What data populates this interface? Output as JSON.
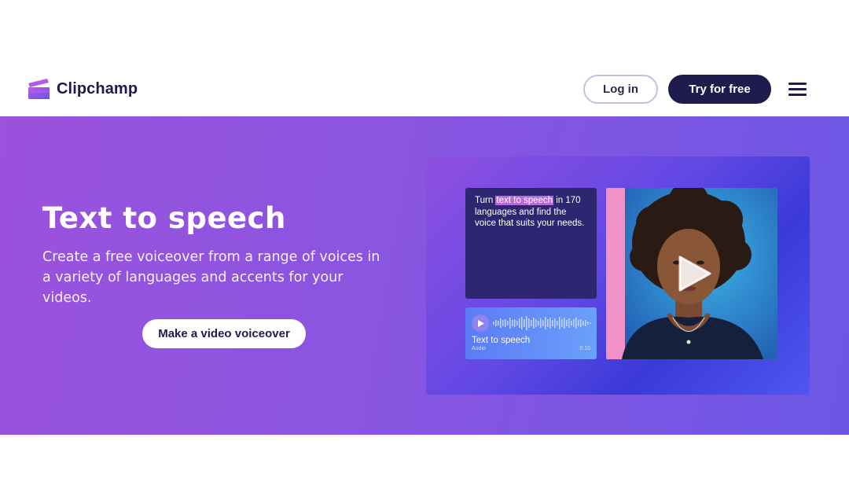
{
  "header": {
    "brand": "Clipchamp",
    "login_label": "Log in",
    "try_label": "Try for free",
    "menu_icon": "hamburger-menu-icon"
  },
  "hero": {
    "title": "Text to speech",
    "subtitle": "Create a free voiceover from a range of voices in a variety of languages and accents for your videos.",
    "cta_label": "Make a video voiceover",
    "colors": {
      "gradient_start": "#9b52dc",
      "gradient_end": "#6c56e6",
      "dark_navy": "#1f1b4d"
    }
  },
  "illustration": {
    "text_card": {
      "prefix": "Turn ",
      "highlight": "text to speech",
      "suffix": " in 170 languages and find the voice that suits your needs."
    },
    "audio_card": {
      "title": "Text to speech",
      "subtitle": "Audio",
      "time": "0:10",
      "play_icon": "play-icon"
    },
    "video_play_icon": "play-icon"
  }
}
